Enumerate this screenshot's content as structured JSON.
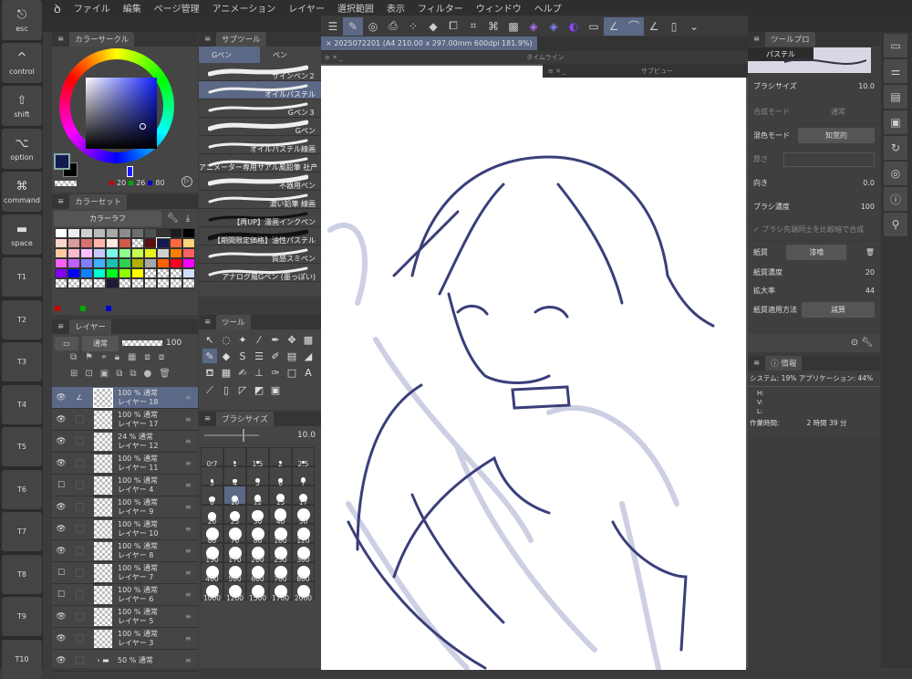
{
  "keys": [
    {
      "glyph": "⎋",
      "label": "esc"
    },
    {
      "glyph": "^",
      "label": "control"
    },
    {
      "glyph": "⇧",
      "label": "shift"
    },
    {
      "glyph": "⌥",
      "label": "option"
    },
    {
      "glyph": "⌘",
      "label": "command"
    },
    {
      "glyph": "▬",
      "label": "space"
    },
    {
      "label": "T1"
    },
    {
      "label": "T2"
    },
    {
      "label": "T3"
    },
    {
      "label": "T4"
    },
    {
      "label": "T5"
    },
    {
      "label": "T6"
    },
    {
      "label": "T7"
    },
    {
      "label": "T8"
    },
    {
      "label": "T9"
    },
    {
      "label": "T10"
    }
  ],
  "menu": [
    "ファイル",
    "編集",
    "ページ管理",
    "アニメーション",
    "レイヤー",
    "選択範囲",
    "表示",
    "フィルター",
    "ウィンドウ",
    "ヘルプ"
  ],
  "color_circle": {
    "title": "カラーサークル",
    "r": "20",
    "g": "26",
    "b": "80",
    "main_color": "#141a50",
    "sub_color": "#000000"
  },
  "color_set": {
    "title": "カラーセット",
    "set_name": "カラーラフ",
    "swatches": [
      "#ffffff",
      "#eeeeee",
      "#d0d0d0",
      "#bbbbbb",
      "#a8a8a8",
      "#8c8c8c",
      "#6e6e6e",
      "#505050",
      "#333333",
      "#1c1c1c",
      "#000000",
      "#ffd7c9",
      "#d89c9c",
      "#d8736f",
      "#ffb6a9",
      "#ffe8e0",
      "#d05a48",
      "checker",
      "#5a1010",
      "#141a50",
      "#ff6a3c",
      "#ffd27a",
      "#ffc8a0",
      "#ffb8d0",
      "#ffc0ff",
      "#c8c8ff",
      "#7affe8",
      "#8cff8c",
      "#c8ff50",
      "#e8f020",
      "#d0d0d0",
      "#ff8000",
      "#ff6060",
      "#ff60ff",
      "#c060ff",
      "#8080ff",
      "#40b0ff",
      "#20c0b0",
      "#30d050",
      "#b0b000",
      "#a8a8a8",
      "#ff6000",
      "#ff0020",
      "#ff00ff",
      "#8000ff",
      "#0000ff",
      "#1080ff",
      "#00ffd0",
      "#00ff20",
      "#90ff00",
      "#ffff00",
      "checker",
      "checker",
      "checker",
      "#d0e0ff",
      "checker",
      "checker",
      "checker",
      "checker",
      "#201838",
      "checker",
      "checker",
      "checker",
      "checker",
      "checker",
      "checker"
    ]
  },
  "subtool": {
    "title": "サブツール",
    "tabs": [
      "Gペン",
      "ペン"
    ],
    "items": [
      "サインペン２",
      "オイルパステル",
      "Gペン３",
      "Gペン",
      "オイルパステル線画",
      "アニメーター専用サアル風鉛筆 社产",
      "不器用ペン",
      "濃い鉛筆 線画",
      "【再UP】漫画インクペン",
      "【期間限定価格】油性パステル",
      "質感スミペン",
      "アナログ風Gペン (墨っぽい)"
    ],
    "selected": 1
  },
  "tool": {
    "title": "ツール",
    "icons": [
      "cursor",
      "lasso",
      "magic-wand",
      "eyedropper",
      "pen",
      "move",
      "qr",
      "brush",
      "eraser",
      "S",
      "lines",
      "pencil-2",
      "gradient",
      "fill",
      "bucket",
      "color-img",
      "pen-fill",
      "stamp",
      "pen-3",
      "square",
      "A",
      "shape",
      "ruler",
      "crop",
      "figure",
      "frame"
    ]
  },
  "brush_size": {
    "title": "ブラシサイズ",
    "value": "10.0",
    "sizes": [
      "0.7",
      "1",
      "1.5",
      "2",
      "2.5",
      "3",
      "4",
      "5",
      "6",
      "7",
      "8",
      "10",
      "12",
      "15",
      "17",
      "20",
      "25",
      "30",
      "40",
      "50",
      "60",
      "70",
      "80",
      "100",
      "120",
      "150",
      "170",
      "200",
      "250",
      "300",
      "400",
      "500",
      "600",
      "700",
      "800",
      "1000",
      "1200",
      "1500",
      "1700",
      "2000"
    ],
    "selected": "10"
  },
  "layer": {
    "title": "レイヤー",
    "blend": "通常",
    "opacity": "100",
    "layers": [
      {
        "op": "100 %",
        "mode": "通常",
        "name": "レイヤー 18",
        "eye": true,
        "sel": true
      },
      {
        "op": "100 %",
        "mode": "通常",
        "name": "レイヤー 17",
        "eye": true
      },
      {
        "op": "24 %",
        "mode": "通常",
        "name": "レイヤー 12",
        "eye": true
      },
      {
        "op": "100 %",
        "mode": "通常",
        "name": "レイヤー 11",
        "eye": true
      },
      {
        "op": "100 %",
        "mode": "通常",
        "name": "レイヤー 4",
        "eye": false
      },
      {
        "op": "100 %",
        "mode": "通常",
        "name": "レイヤー 9",
        "eye": true
      },
      {
        "op": "100 %",
        "mode": "通常",
        "name": "レイヤー 10",
        "eye": true
      },
      {
        "op": "100 %",
        "mode": "通常",
        "name": "レイヤー 8",
        "eye": true
      },
      {
        "op": "100 %",
        "mode": "通常",
        "name": "レイヤー 7",
        "eye": false
      },
      {
        "op": "100 %",
        "mode": "通常",
        "name": "レイヤー 6",
        "eye": false
      },
      {
        "op": "100 %",
        "mode": "通常",
        "name": "レイヤー 5",
        "eye": true
      },
      {
        "op": "100 %",
        "mode": "通常",
        "name": "レイヤー 3",
        "eye": true
      },
      {
        "op": "50 %",
        "mode": "通常",
        "name": "",
        "eye": true,
        "folder": true
      }
    ]
  },
  "document": {
    "tab": "2025072201 (A4 210.00 x 297.00mm 600dpi 181.9%)",
    "timeline": "タイムライン",
    "subview": "サブビュー"
  },
  "props": {
    "title": "ツールプロ",
    "preset": "パステル",
    "brush_size_label": "ブラシサイズ",
    "brush_size": "10.0",
    "composite_label": "合成モード",
    "composite": "通常",
    "mix_label": "混色モード",
    "mix": "知覚的",
    "thickness_label": "厚さ",
    "direction_label": "向き",
    "direction": "0.0",
    "density_label": "ブラシ濃度",
    "density": "100",
    "compare_label": "ブラシ先端同士を比較暗で合成",
    "paper_label": "紙質",
    "paper": "漆喰",
    "paper_density_label": "紙質濃度",
    "paper_density": "20",
    "scale_label": "拡大率",
    "scale": "44",
    "apply_label": "紙質適用方法",
    "apply": "減算"
  },
  "info": {
    "title": "情報",
    "usage": "システム: 19%  アプリケーション: 44%",
    "h": "H:",
    "v": "V:",
    "l": "L:",
    "work_label": "作業時間:",
    "work_time": "2 時間 39 分"
  },
  "right_icons": [
    "canvas-icon",
    "sliders-icon",
    "animation-icon",
    "navigator-icon",
    "history-icon",
    "layer-search-icon",
    "info-icon",
    "search-icon"
  ],
  "accent": "#5b6886"
}
